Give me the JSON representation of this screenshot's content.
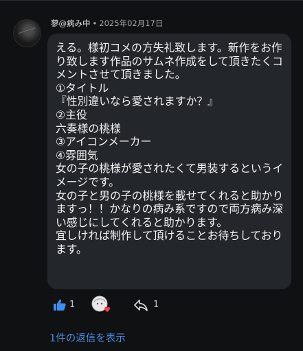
{
  "comment": {
    "author": "蓼@病み中",
    "separator": "•",
    "date": "2025年02月17日",
    "text": "える。様初コメの方失礼致します。新作をお作り致します作品のサムネ作成をして頂きたくコメントさせて頂きました。\n①タイトル\n『性別違いなら愛されますか？』\n②主役\n六奏様の桃様\n③アイコンメーカー\n④雰囲気\n女の子の桃様が愛されたくて男装するというイメージです。\n女の子と男の子の桃様を載せてくれると助かりますっ！！かなりの病み系ですので両方病み深い感じにしてくれると助かります。\n宜しければ制作して頂けることお待ちしております。"
  },
  "actions": {
    "like_icon": "thumbs-up-icon",
    "like_count": "1",
    "creator_heart_icon": "creator-heart-icon",
    "reply_icon": "reply-arrow-icon",
    "reply_count": "1",
    "accent_color": "#3d8ef0"
  },
  "replies": {
    "view_label": "1件の返信を表示"
  }
}
